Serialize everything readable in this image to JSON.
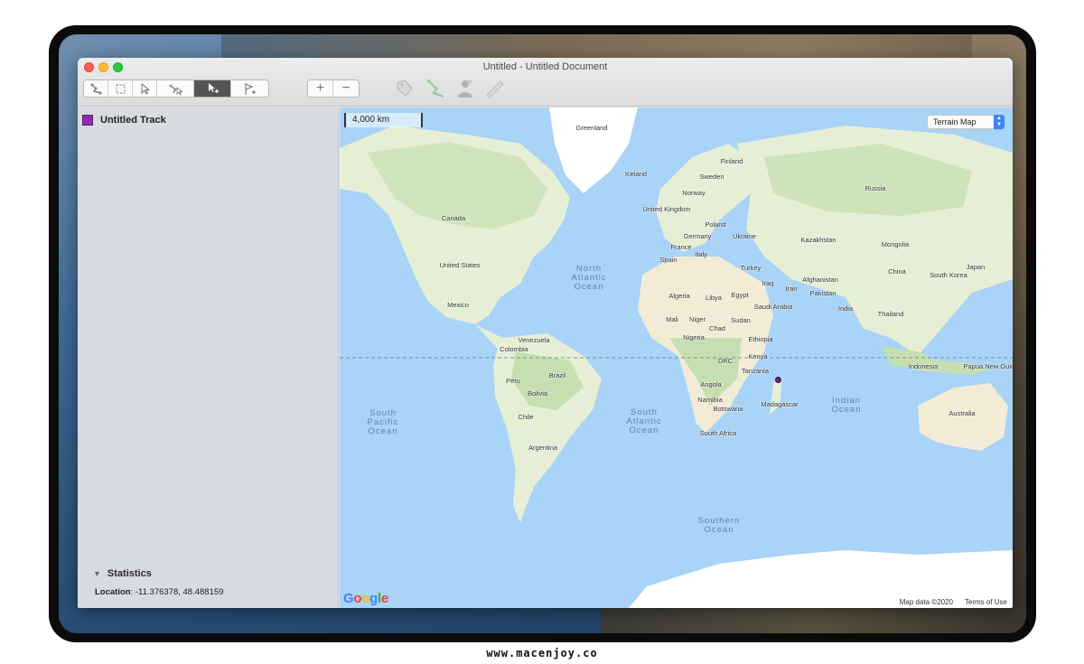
{
  "window": {
    "title": "Untitled - Untitled Document"
  },
  "toolbar": {
    "tools": [
      "route-tool-icon",
      "select-area-icon",
      "pointer-icon",
      "multi-select-icon",
      "add-point-icon",
      "flag-add-icon"
    ],
    "active_tool": "add-point-icon",
    "zoom_in_label": "+",
    "zoom_out_label": "−",
    "extra_icons": [
      "tag-icon",
      "route-edit-icon",
      "person-icon",
      "ruler-icon"
    ]
  },
  "sidebar": {
    "track": {
      "name": "Untitled Track",
      "color": "#8f2fad"
    },
    "statistics": {
      "title": "Statistics",
      "location_label": "Location",
      "location_value": ": -11.376378, 48.488159"
    }
  },
  "map": {
    "scale_label": "4,000 km",
    "map_type": "Terrain Map",
    "google_letters": [
      "G",
      "o",
      "o",
      "g",
      "l",
      "e"
    ],
    "map_data": "Map data ©2020",
    "terms": "Terms of Use",
    "colors": {
      "ocean": "#a9d3f7",
      "land": "#e6efd6",
      "vegetation": "#c6dfb0",
      "desert": "#f2ecd6",
      "ice": "#ffffff"
    },
    "countries": [
      "Greenland",
      "Iceland",
      "Finland",
      "Sweden",
      "Norway",
      "Russia",
      "United Kingdom",
      "Canada",
      "Poland",
      "Germany",
      "Ukraine",
      "France",
      "Kazakhstan",
      "Mongolia",
      "Italy",
      "Spain",
      "Turkey",
      "United States",
      "Afghanistan",
      "China",
      "South Korea",
      "Japan",
      "Iraq",
      "Iran",
      "Pakistan",
      "Algeria",
      "Libya",
      "Egypt",
      "Saudi Arabia",
      "India",
      "Mexico",
      "Mali",
      "Niger",
      "Sudan",
      "Chad",
      "Thailand",
      "Venezuela",
      "Nigeria",
      "Ethiopia",
      "Colombia",
      "Kenya",
      "DRC",
      "Indonesia",
      "Tanzania",
      "Papua New Guinea",
      "Peru",
      "Brazil",
      "Angola",
      "Bolivia",
      "Namibia",
      "Madagascar",
      "Chile",
      "Botswana",
      "Australia",
      "South Africa",
      "Argentina"
    ],
    "oceans": [
      "North\nAtlantic\nOcean",
      "South\nPacific\nOcean",
      "South\nAtlantic\nOcean",
      "Indian\nOcean",
      "Southern\nOcean"
    ]
  },
  "footer": {
    "watermark": "www.macenjoy.co"
  }
}
